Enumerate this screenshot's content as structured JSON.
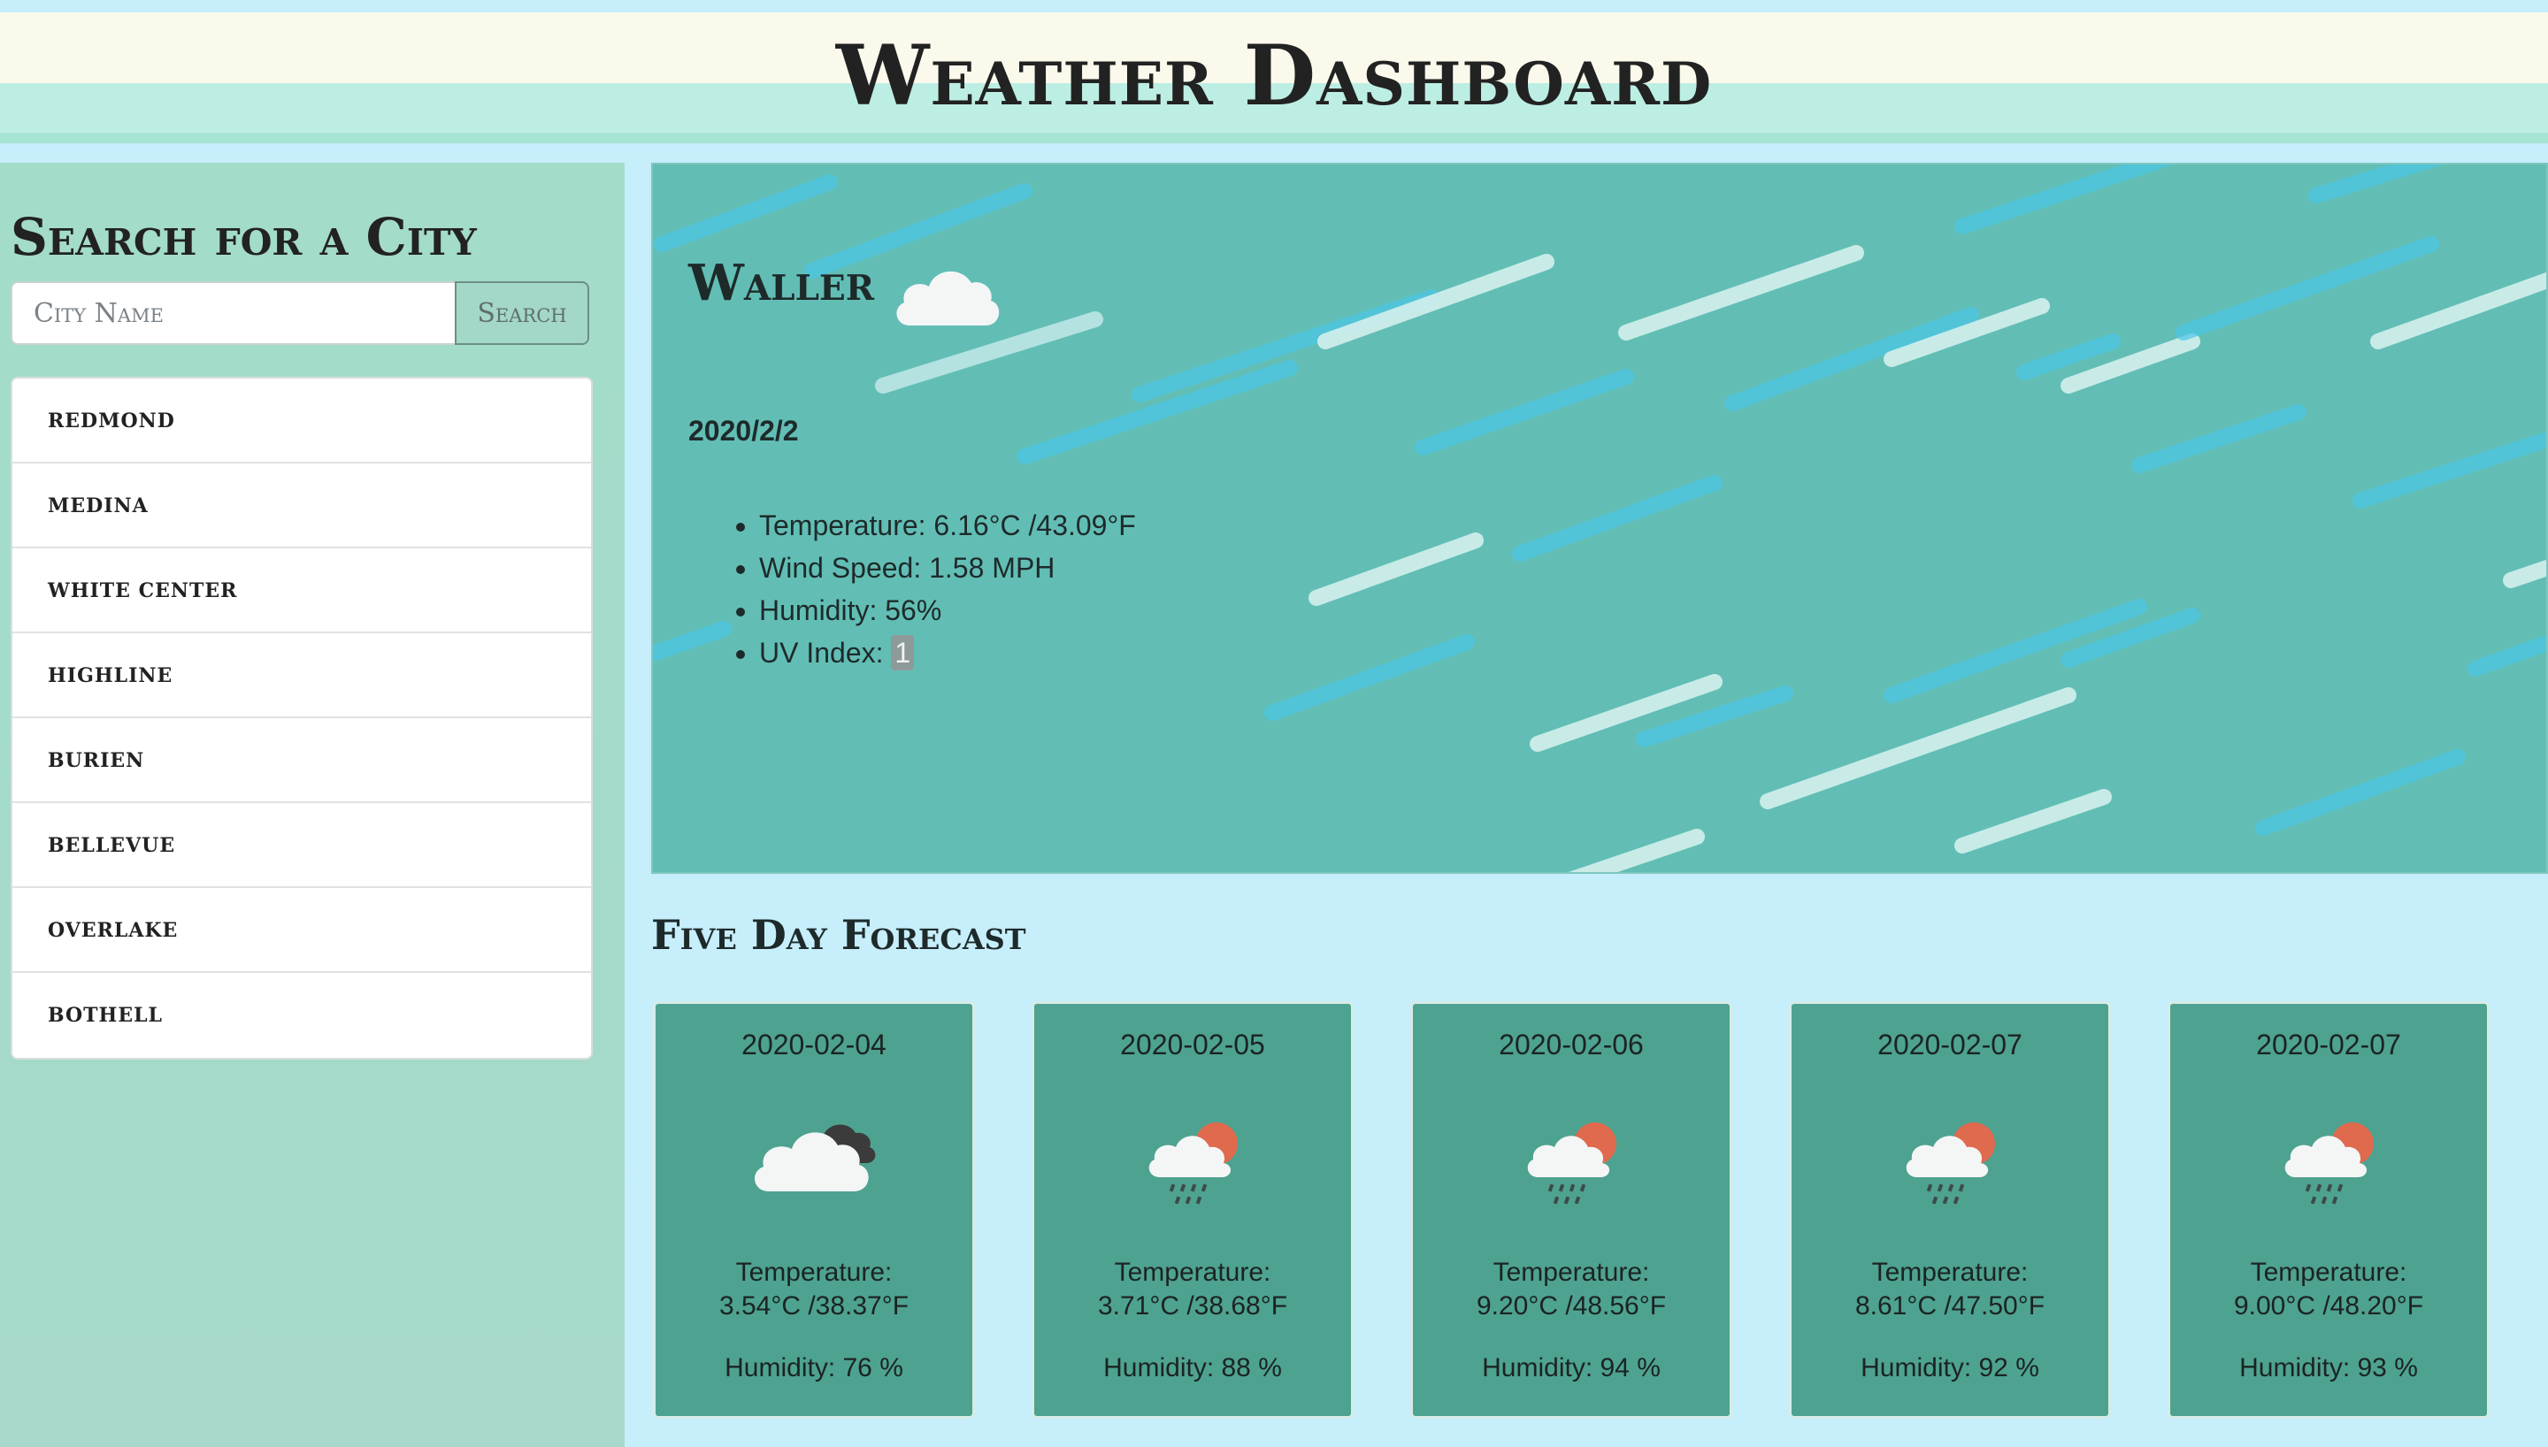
{
  "header": {
    "title": "Weather Dashboard"
  },
  "sidebar": {
    "title": "Search for a City",
    "search": {
      "placeholder": "City Name",
      "button_label": "Search"
    },
    "cities": [
      "REDMOND",
      "MEDINA",
      "WHITE CENTER",
      "HIGHLINE",
      "BURIEN",
      "BELLEVUE",
      "OVERLAKE",
      "BOTHELL"
    ]
  },
  "current": {
    "city": "Waller",
    "icon": "cloud-icon",
    "date": "2020/2/2",
    "temperature": "Temperature: 6.16°C /43.09°F",
    "wind": "Wind Speed: 1.58 MPH",
    "humidity": "Humidity: 56%",
    "uv_label": "UV Index: ",
    "uv_value": "1"
  },
  "forecast": {
    "title": "Five Day Forecast",
    "temp_label": "Temperature:",
    "days": [
      {
        "date": "2020-02-04",
        "icon": "cloudy-icon",
        "temp": "3.54°C /38.37°F",
        "humidity": "Humidity: 76 %"
      },
      {
        "date": "2020-02-05",
        "icon": "sun-cloud-rain-icon",
        "temp": "3.71°C /38.68°F",
        "humidity": "Humidity: 88 %"
      },
      {
        "date": "2020-02-06",
        "icon": "sun-cloud-rain-icon",
        "temp": "9.20°C /48.56°F",
        "humidity": "Humidity: 94 %"
      },
      {
        "date": "2020-02-07",
        "icon": "sun-cloud-rain-icon",
        "temp": "8.61°C /47.50°F",
        "humidity": "Humidity: 92 %"
      },
      {
        "date": "2020-02-07",
        "icon": "sun-cloud-rain-icon",
        "temp": "9.00°C /48.20°F",
        "humidity": "Humidity: 93 %"
      }
    ]
  },
  "colors": {
    "background": "#c6eefb",
    "header": "#fbf9ec",
    "sidebar": "#a3dcc9",
    "current_panel": "#62beb5",
    "forecast_card": "#4ea290",
    "sun": "#e06a4e"
  }
}
